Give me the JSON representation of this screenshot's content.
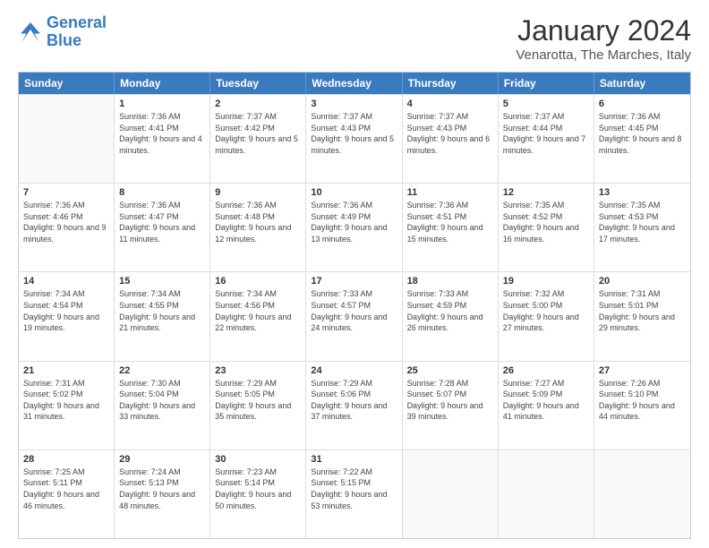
{
  "header": {
    "logo_line1": "General",
    "logo_line2": "Blue",
    "month": "January 2024",
    "location": "Venarotta, The Marches, Italy"
  },
  "weekdays": [
    "Sunday",
    "Monday",
    "Tuesday",
    "Wednesday",
    "Thursday",
    "Friday",
    "Saturday"
  ],
  "rows": [
    [
      {
        "day": "",
        "sunrise": "",
        "sunset": "",
        "daylight": ""
      },
      {
        "day": "1",
        "sunrise": "Sunrise: 7:36 AM",
        "sunset": "Sunset: 4:41 PM",
        "daylight": "Daylight: 9 hours and 4 minutes."
      },
      {
        "day": "2",
        "sunrise": "Sunrise: 7:37 AM",
        "sunset": "Sunset: 4:42 PM",
        "daylight": "Daylight: 9 hours and 5 minutes."
      },
      {
        "day": "3",
        "sunrise": "Sunrise: 7:37 AM",
        "sunset": "Sunset: 4:43 PM",
        "daylight": "Daylight: 9 hours and 5 minutes."
      },
      {
        "day": "4",
        "sunrise": "Sunrise: 7:37 AM",
        "sunset": "Sunset: 4:43 PM",
        "daylight": "Daylight: 9 hours and 6 minutes."
      },
      {
        "day": "5",
        "sunrise": "Sunrise: 7:37 AM",
        "sunset": "Sunset: 4:44 PM",
        "daylight": "Daylight: 9 hours and 7 minutes."
      },
      {
        "day": "6",
        "sunrise": "Sunrise: 7:36 AM",
        "sunset": "Sunset: 4:45 PM",
        "daylight": "Daylight: 9 hours and 8 minutes."
      }
    ],
    [
      {
        "day": "7",
        "sunrise": "Sunrise: 7:36 AM",
        "sunset": "Sunset: 4:46 PM",
        "daylight": "Daylight: 9 hours and 9 minutes."
      },
      {
        "day": "8",
        "sunrise": "Sunrise: 7:36 AM",
        "sunset": "Sunset: 4:47 PM",
        "daylight": "Daylight: 9 hours and 11 minutes."
      },
      {
        "day": "9",
        "sunrise": "Sunrise: 7:36 AM",
        "sunset": "Sunset: 4:48 PM",
        "daylight": "Daylight: 9 hours and 12 minutes."
      },
      {
        "day": "10",
        "sunrise": "Sunrise: 7:36 AM",
        "sunset": "Sunset: 4:49 PM",
        "daylight": "Daylight: 9 hours and 13 minutes."
      },
      {
        "day": "11",
        "sunrise": "Sunrise: 7:36 AM",
        "sunset": "Sunset: 4:51 PM",
        "daylight": "Daylight: 9 hours and 15 minutes."
      },
      {
        "day": "12",
        "sunrise": "Sunrise: 7:35 AM",
        "sunset": "Sunset: 4:52 PM",
        "daylight": "Daylight: 9 hours and 16 minutes."
      },
      {
        "day": "13",
        "sunrise": "Sunrise: 7:35 AM",
        "sunset": "Sunset: 4:53 PM",
        "daylight": "Daylight: 9 hours and 17 minutes."
      }
    ],
    [
      {
        "day": "14",
        "sunrise": "Sunrise: 7:34 AM",
        "sunset": "Sunset: 4:54 PM",
        "daylight": "Daylight: 9 hours and 19 minutes."
      },
      {
        "day": "15",
        "sunrise": "Sunrise: 7:34 AM",
        "sunset": "Sunset: 4:55 PM",
        "daylight": "Daylight: 9 hours and 21 minutes."
      },
      {
        "day": "16",
        "sunrise": "Sunrise: 7:34 AM",
        "sunset": "Sunset: 4:56 PM",
        "daylight": "Daylight: 9 hours and 22 minutes."
      },
      {
        "day": "17",
        "sunrise": "Sunrise: 7:33 AM",
        "sunset": "Sunset: 4:57 PM",
        "daylight": "Daylight: 9 hours and 24 minutes."
      },
      {
        "day": "18",
        "sunrise": "Sunrise: 7:33 AM",
        "sunset": "Sunset: 4:59 PM",
        "daylight": "Daylight: 9 hours and 26 minutes."
      },
      {
        "day": "19",
        "sunrise": "Sunrise: 7:32 AM",
        "sunset": "Sunset: 5:00 PM",
        "daylight": "Daylight: 9 hours and 27 minutes."
      },
      {
        "day": "20",
        "sunrise": "Sunrise: 7:31 AM",
        "sunset": "Sunset: 5:01 PM",
        "daylight": "Daylight: 9 hours and 29 minutes."
      }
    ],
    [
      {
        "day": "21",
        "sunrise": "Sunrise: 7:31 AM",
        "sunset": "Sunset: 5:02 PM",
        "daylight": "Daylight: 9 hours and 31 minutes."
      },
      {
        "day": "22",
        "sunrise": "Sunrise: 7:30 AM",
        "sunset": "Sunset: 5:04 PM",
        "daylight": "Daylight: 9 hours and 33 minutes."
      },
      {
        "day": "23",
        "sunrise": "Sunrise: 7:29 AM",
        "sunset": "Sunset: 5:05 PM",
        "daylight": "Daylight: 9 hours and 35 minutes."
      },
      {
        "day": "24",
        "sunrise": "Sunrise: 7:29 AM",
        "sunset": "Sunset: 5:06 PM",
        "daylight": "Daylight: 9 hours and 37 minutes."
      },
      {
        "day": "25",
        "sunrise": "Sunrise: 7:28 AM",
        "sunset": "Sunset: 5:07 PM",
        "daylight": "Daylight: 9 hours and 39 minutes."
      },
      {
        "day": "26",
        "sunrise": "Sunrise: 7:27 AM",
        "sunset": "Sunset: 5:09 PM",
        "daylight": "Daylight: 9 hours and 41 minutes."
      },
      {
        "day": "27",
        "sunrise": "Sunrise: 7:26 AM",
        "sunset": "Sunset: 5:10 PM",
        "daylight": "Daylight: 9 hours and 44 minutes."
      }
    ],
    [
      {
        "day": "28",
        "sunrise": "Sunrise: 7:25 AM",
        "sunset": "Sunset: 5:11 PM",
        "daylight": "Daylight: 9 hours and 46 minutes."
      },
      {
        "day": "29",
        "sunrise": "Sunrise: 7:24 AM",
        "sunset": "Sunset: 5:13 PM",
        "daylight": "Daylight: 9 hours and 48 minutes."
      },
      {
        "day": "30",
        "sunrise": "Sunrise: 7:23 AM",
        "sunset": "Sunset: 5:14 PM",
        "daylight": "Daylight: 9 hours and 50 minutes."
      },
      {
        "day": "31",
        "sunrise": "Sunrise: 7:22 AM",
        "sunset": "Sunset: 5:15 PM",
        "daylight": "Daylight: 9 hours and 53 minutes."
      },
      {
        "day": "",
        "sunrise": "",
        "sunset": "",
        "daylight": ""
      },
      {
        "day": "",
        "sunrise": "",
        "sunset": "",
        "daylight": ""
      },
      {
        "day": "",
        "sunrise": "",
        "sunset": "",
        "daylight": ""
      }
    ]
  ]
}
